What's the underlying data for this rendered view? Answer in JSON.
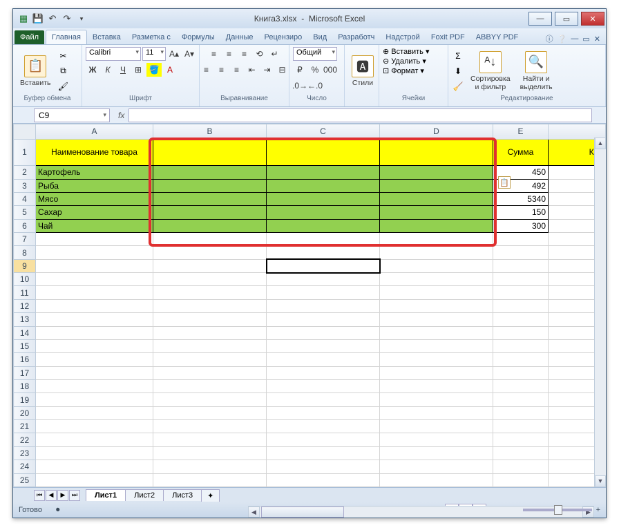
{
  "title": {
    "doc": "Книга3.xlsx",
    "app": "Microsoft Excel"
  },
  "tabs": {
    "file": "Файл",
    "home": "Главная",
    "insert": "Вставка",
    "layout": "Разметка с",
    "formulas": "Формулы",
    "data": "Данные",
    "review": "Рецензиро",
    "view": "Вид",
    "developer": "Разработч",
    "addins": "Надстрой",
    "foxit": "Foxit PDF",
    "abbyy": "ABBYY PDF"
  },
  "ribbon": {
    "paste": "Вставить",
    "clipboard": "Буфер обмена",
    "font_name": "Calibri",
    "font_size": "11",
    "font_group": "Шрифт",
    "align_group": "Выравнивание",
    "number_format": "Общий",
    "number_group": "Число",
    "styles_btn": "Стили",
    "insert_cell": "Вставить",
    "delete_cell": "Удалить",
    "format_cell": "Формат",
    "cells_group": "Ячейки",
    "sort_filter": "Сортировка\nи фильтр",
    "find_select": "Найти и\nвыделить",
    "editing_group": "Редактирование"
  },
  "namebox": "C9",
  "columns": [
    "A",
    "B",
    "C",
    "D",
    "E"
  ],
  "last_col_partial": "Кол",
  "row_headers": {
    "r1c1": "Наименование товара",
    "r1c5": "Сумма"
  },
  "data_rows": [
    {
      "name": "Картофель",
      "sum": "450"
    },
    {
      "name": "Рыба",
      "sum": "492"
    },
    {
      "name": "Мясо",
      "sum": "5340"
    },
    {
      "name": "Сахар",
      "sum": "150"
    },
    {
      "name": "Чай",
      "sum": "300"
    }
  ],
  "sheets": {
    "s1": "Лист1",
    "s2": "Лист2",
    "s3": "Лист3"
  },
  "status": "Готово",
  "zoom": "100%"
}
